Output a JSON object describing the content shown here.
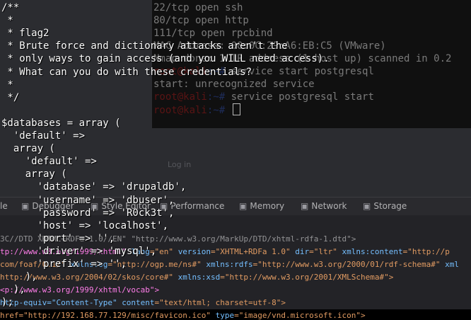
{
  "browser": {
    "heading": "",
    "login_label": "Log in"
  },
  "devtools": {
    "tabs": [
      {
        "label": "le",
        "icon": ""
      },
      {
        "label": "Debugger",
        "icon": "debugger-icon"
      },
      {
        "label": "Style Editor",
        "icon": "style-editor-icon"
      },
      {
        "label": "Performance",
        "icon": "performance-icon"
      },
      {
        "label": "Memory",
        "icon": "memory-icon"
      },
      {
        "label": "Network",
        "icon": "network-icon"
      },
      {
        "label": "Storage",
        "icon": "storage-icon"
      }
    ],
    "source_lines": [
      [
        {
          "t": "3C//DTD XHTML+RDFa 1.0//EN\" ",
          "c": "c-grey"
        },
        {
          "t": "\"http://www.w3.org/MarkUp/DTD/xhtml-rdfa-1.dtd\">",
          "c": "c-grey"
        }
      ],
      [
        {
          "t": "tp://www.w3.org/1999/xhtml\" ",
          "c": "c-pink"
        },
        {
          "t": "lang",
          "c": "c-blue"
        },
        {
          "t": "=\"en\" ",
          "c": "c-orange"
        },
        {
          "t": "version",
          "c": "c-blue"
        },
        {
          "t": "=\"XHTML+RDFa 1.0\" ",
          "c": "c-orange"
        },
        {
          "t": "dir",
          "c": "c-blue"
        },
        {
          "t": "=\"ltr\" ",
          "c": "c-orange"
        },
        {
          "t": "xmlns:content",
          "c": "c-blue"
        },
        {
          "t": "=\"http://p",
          "c": "c-orange"
        }
      ],
      [
        {
          "t": "com/foaf/0.1/\" ",
          "c": "c-orange"
        },
        {
          "t": "xmlns:og",
          "c": "c-blue"
        },
        {
          "t": "=\"http://ogp.me/ns#\" ",
          "c": "c-orange"
        },
        {
          "t": "xmlns:rdfs",
          "c": "c-blue"
        },
        {
          "t": "=\"http://www.w3.org/2000/01/rdf-schema#\" ",
          "c": "c-orange"
        },
        {
          "t": "xml",
          "c": "c-blue"
        }
      ],
      [
        {
          "t": "http://www.w3.org/2004/02/skos/core#\" ",
          "c": "c-orange"
        },
        {
          "t": "xmlns:xsd",
          "c": "c-blue"
        },
        {
          "t": "=\"http://www.w3.org/2001/XMLSchema#\">",
          "c": "c-orange"
        }
      ],
      [
        {
          "t": "<p://www.w3.org/1999/xhtml/vocab\">",
          "c": "c-pink"
        }
      ],
      [
        {
          "t": "http-equiv=\"Content-Type\" ",
          "c": "c-blue"
        },
        {
          "t": "content",
          "c": "c-blue"
        },
        {
          "t": "=\"text/html; charset=utf-8\">",
          "c": "c-orange"
        }
      ],
      [
        {
          "t": "href=\"http://192.168.77.129/misc/favicon.ico\" ",
          "c": "c-orange"
        },
        {
          "t": "type",
          "c": "c-blue"
        },
        {
          "t": "=\"image/vnd.microsoft.icon\">",
          "c": "c-orange"
        }
      ]
    ]
  },
  "terminal": {
    "lines": [
      {
        "text": "22/tcp  open  ssh"
      },
      {
        "text": "80/tcp  open  http"
      },
      {
        "text": "111/tcp open  rpcbind"
      },
      {
        "text": "MAC Address: 00:0C:29:A6:EB:C5 (VMware)"
      },
      {
        "text": "Nmap done: 1 IP address (1 host up) scanned in 0.2"
      }
    ],
    "prompt_user": "root@kali",
    "prompt_path": ":~# ",
    "commands": [
      "service start postgresql",
      "service postgresql start",
      ""
    ],
    "error_line": "start: unrecognized service"
  },
  "code": {
    "lines": [
      "/**",
      " *",
      " * flag2",
      " * Brute force and dictionary attacks aren't the",
      " * only ways to gain access (and you WILL need access).",
      " * What can you do with these credentials?",
      " *",
      " */",
      "",
      "$databases = array (",
      "  'default' =>",
      "  array (",
      "    'default' =>",
      "    array (",
      "      'database' => 'drupaldb',",
      "      'username' => 'dbuser',",
      "      'password' => 'R0ck3t',",
      "      'host' => 'localhost',",
      "      'port' => '',",
      "      'driver' => 'mysql',",
      "      'prefix' => '',",
      "    ),",
      "  ),",
      ");"
    ]
  }
}
